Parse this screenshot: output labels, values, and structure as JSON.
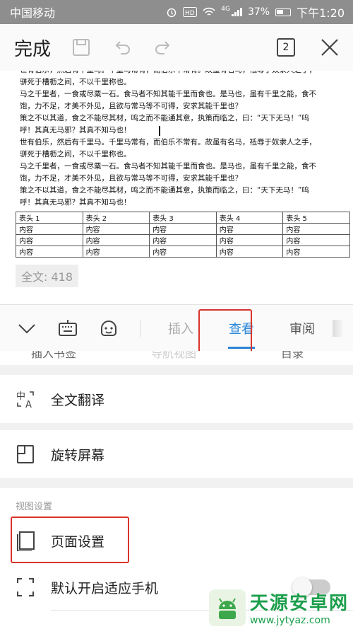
{
  "status_bar": {
    "carrier": "中国移动",
    "network": "4G",
    "battery": "37%",
    "time": "下午1:20"
  },
  "toolbar": {
    "done_label": "完成",
    "page_count": "2"
  },
  "document": {
    "lines": [
      "世有伯乐，然后有千里马。千里马常有，而伯乐不常有。故虽有名马，祗辱于奴隶人之手，",
      "骈死于槽枥之间，不以千里称也。",
      "马之千里者，一食或尽粟一石。食马者不知其能千里而食也。是马也，虽有千里之能，食不",
      "饱，力不足，才美不外见，且欲与常马等不可得，安求其能千里也？",
      "策之不以其道，食之不能尽其材，鸣之而不能通其意，执策而临之，曰：“天下无马！”呜",
      "呼！其真无马邪？其真不知马也！",
      "世有伯乐，然后有千里马。千里马常有，而伯乐不常有。故虽有名马，祗辱于奴隶人之手，",
      "骈死于槽枥之间，不以千里称也。",
      "马之千里者，一食或尽粟一石。食马者不知其能千里而食也。是马也，虽有千里之能，食不",
      "饱，力不足，才美不外见，且欲与常马等不可得，安求其能千里也？",
      "策之不以其道，食之不能尽其材，鸣之而不能通其意，执策而临之，曰：“天下无马！”呜",
      "呼！其真无马邪？其真不知马也！"
    ],
    "table": {
      "headers": [
        "表头 1",
        "表头 2",
        "表头 3",
        "表头 4",
        "表头 5"
      ],
      "rows": [
        [
          "内容",
          "内容",
          "内容",
          "内容",
          "内容"
        ],
        [
          "内容",
          "内容",
          "内容",
          "内容",
          "内容"
        ],
        [
          "内容",
          "内容",
          "内容",
          "内容",
          "内容"
        ]
      ]
    },
    "word_count": "全文: 418"
  },
  "tabs": {
    "items": [
      "插入",
      "查看",
      "审阅"
    ],
    "active": "查看"
  },
  "hidden_row": [
    "插入书签",
    "导航视图",
    "目录"
  ],
  "menu": {
    "translate": "全文翻译",
    "rotate": "旋转屏幕",
    "section_label": "视图设置",
    "page_setup": "页面设置",
    "fit_phone": "默认开启适应手机"
  },
  "watermark": {
    "title": "天源安卓网",
    "url": "www.jytyaz.com"
  },
  "colors": {
    "accent": "#2a86d8",
    "highlight": "#d9342b",
    "watermark": "#1b9e4b"
  }
}
